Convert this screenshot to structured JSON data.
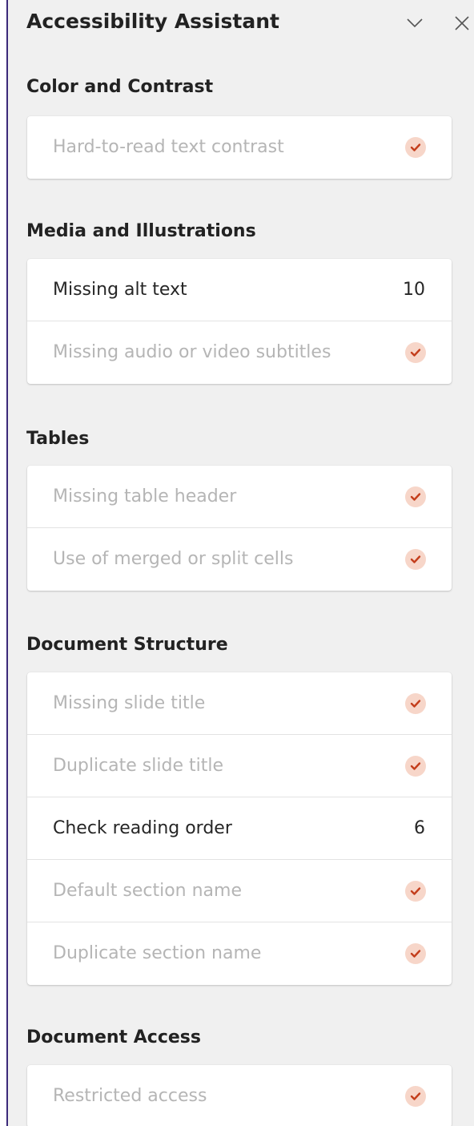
{
  "pane": {
    "title": "Accessibility Assistant",
    "collapse_icon": "chevron-down-icon",
    "close_icon": "close-icon"
  },
  "colors": {
    "accent": "#c43e1c",
    "check_bg": "#f7d6c9",
    "border": "#3b2a7a"
  },
  "sections": [
    {
      "title": "Color and Contrast",
      "items": [
        {
          "label": "Hard-to-read text contrast",
          "status": "passed"
        }
      ]
    },
    {
      "title": "Media and Illustrations",
      "items": [
        {
          "label": "Missing alt text",
          "status": "issues",
          "count": "10"
        },
        {
          "label": "Missing audio or video subtitles",
          "status": "passed"
        }
      ]
    },
    {
      "title": "Tables",
      "items": [
        {
          "label": "Missing table header",
          "status": "passed"
        },
        {
          "label": "Use of merged or split cells",
          "status": "passed"
        }
      ]
    },
    {
      "title": "Document Structure",
      "items": [
        {
          "label": "Missing slide title",
          "status": "passed"
        },
        {
          "label": "Duplicate slide title",
          "status": "passed"
        },
        {
          "label": "Check reading order",
          "status": "issues",
          "count": "6"
        },
        {
          "label": "Default section name",
          "status": "passed"
        },
        {
          "label": "Duplicate section name",
          "status": "passed"
        }
      ]
    },
    {
      "title": "Document Access",
      "items": [
        {
          "label": "Restricted access",
          "status": "passed"
        }
      ]
    }
  ]
}
